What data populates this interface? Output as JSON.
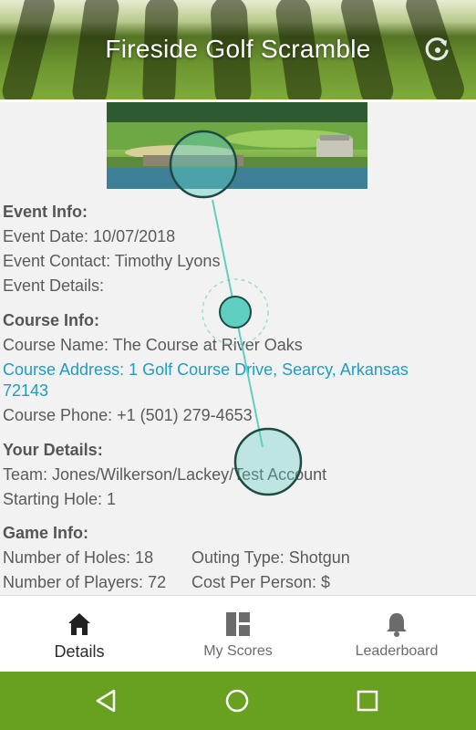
{
  "header": {
    "title": "Fireside Golf Scramble",
    "refresh_icon": "refresh-icon"
  },
  "event_info": {
    "heading": "Event Info:",
    "date": "Event Date: 10/07/2018",
    "contact": "Event Contact: Timothy Lyons",
    "details": "Event Details:"
  },
  "course_info": {
    "heading": "Course Info:",
    "name": "Course Name: The Course at River Oaks",
    "address_line1": "Course Address: 1 Golf Course Drive, Searcy, Arkansas",
    "address_line2": "72143",
    "phone": "Course Phone: +1 (501) 279-4653"
  },
  "your_details": {
    "heading": "Your Details:",
    "team": "Team: Jones/Wilkerson/Lackey/Test Account",
    "starting_hole": "Starting Hole: 1"
  },
  "game_info": {
    "heading": "Game Info:",
    "holes": "Number of Holes: 18",
    "outing_type": "Outing Type: Shotgun",
    "players": "Number of Players: 72",
    "cost": "Cost Per Person: $"
  },
  "tabs": [
    {
      "label": "Details",
      "icon": "home-icon",
      "active": true
    },
    {
      "label": "My Scores",
      "icon": "grid-icon",
      "active": false
    },
    {
      "label": "Leaderboard",
      "icon": "bell-icon",
      "active": false
    }
  ],
  "colors": {
    "link": "#1e9cc4",
    "nav_bar": "#68a11f",
    "touch": "#5ecfc0"
  }
}
